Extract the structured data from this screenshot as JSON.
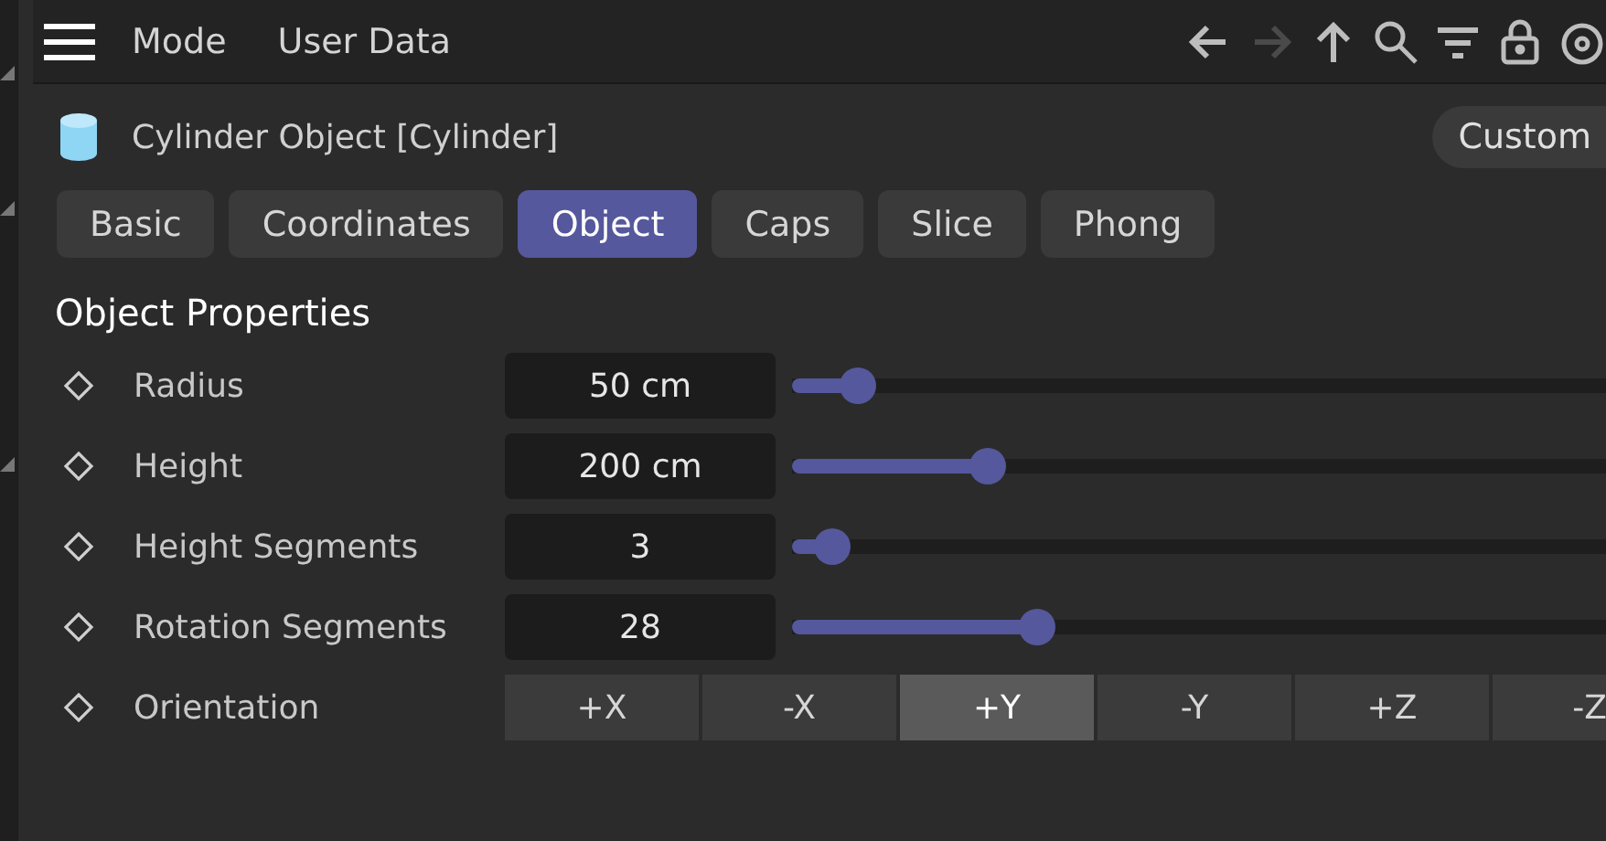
{
  "menu": {
    "items": [
      "Mode",
      "User Data"
    ]
  },
  "toolbar": [
    {
      "kind": "back",
      "disabled": false
    },
    {
      "kind": "forward",
      "disabled": true
    },
    {
      "kind": "up",
      "disabled": false
    },
    {
      "kind": "search",
      "disabled": false
    },
    {
      "kind": "filter",
      "disabled": false
    },
    {
      "kind": "lock",
      "disabled": false
    },
    {
      "kind": "target",
      "disabled": false
    }
  ],
  "object": {
    "title": "Cylinder Object [Cylinder]",
    "preset": "Custom"
  },
  "tabs": [
    {
      "label": "Basic",
      "selected": false
    },
    {
      "label": "Coordinates",
      "selected": false
    },
    {
      "label": "Object",
      "selected": true
    },
    {
      "label": "Caps",
      "selected": false
    },
    {
      "label": "Slice",
      "selected": false
    },
    {
      "label": "Phong",
      "selected": false
    }
  ],
  "section": "Object Properties",
  "params": [
    {
      "kind": "slider",
      "label": "Radius",
      "value": "50 cm",
      "level": 0.08
    },
    {
      "kind": "slider",
      "label": "Height",
      "value": "200 cm",
      "level": 0.24
    },
    {
      "kind": "slider",
      "label": "Height Segments",
      "value": "3",
      "level": 0.05
    },
    {
      "kind": "slider",
      "label": "Rotation Segments",
      "value": "28",
      "level": 0.3
    },
    {
      "kind": "choice",
      "label": "Orientation",
      "options": [
        {
          "label": "+X",
          "selected": false
        },
        {
          "label": "-X",
          "selected": false
        },
        {
          "label": "+Y",
          "selected": true
        },
        {
          "label": "-Y",
          "selected": false
        },
        {
          "label": "+Z",
          "selected": false
        },
        {
          "label": "-Z",
          "selected": false
        }
      ]
    }
  ]
}
